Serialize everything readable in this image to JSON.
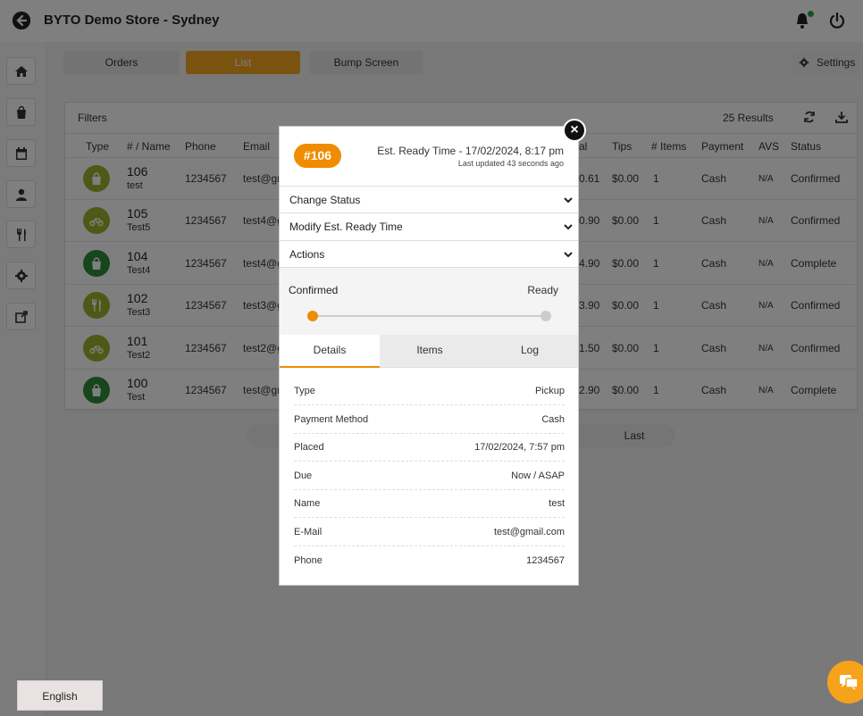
{
  "header": {
    "title": "BYTO Demo Store - Sydney"
  },
  "tabs": {
    "orders": "Orders",
    "list": "List",
    "bump": "Bump Screen",
    "settings": "Settings"
  },
  "panel": {
    "filters": "Filters",
    "results": "25 Results"
  },
  "table": {
    "headers": [
      "Type",
      "# / Name",
      "Phone",
      "Email",
      "al",
      "Tips",
      "# Items",
      "Payment",
      "AVS",
      "Status"
    ],
    "rows": [
      {
        "num": "106",
        "name": "test",
        "phone": "1234567",
        "email": "test@gm",
        "total": "0.61",
        "tips": "$0.00",
        "items": "1",
        "payment": "Cash",
        "avs": "N/A",
        "status": "Confirmed",
        "type_icon": "bag-icon",
        "color": "#a0b12e"
      },
      {
        "num": "105",
        "name": "Test5",
        "phone": "1234567",
        "email": "test4@g",
        "total": "0.90",
        "tips": "$0.00",
        "items": "1",
        "payment": "Cash",
        "avs": "N/A",
        "status": "Confirmed",
        "type_icon": "bike-icon",
        "color": "#a0b12e"
      },
      {
        "num": "104",
        "name": "Test4",
        "phone": "1234567",
        "email": "test4@g",
        "total": "4.90",
        "tips": "$0.00",
        "items": "1",
        "payment": "Cash",
        "avs": "N/A",
        "status": "Complete",
        "type_icon": "bag-icon",
        "color": "#2e8b3a"
      },
      {
        "num": "102",
        "name": "Test3",
        "phone": "1234567",
        "email": "test3@g",
        "total": "3.90",
        "tips": "$0.00",
        "items": "1",
        "payment": "Cash",
        "avs": "N/A",
        "status": "Confirmed",
        "type_icon": "cutlery-icon",
        "color": "#a0b12e"
      },
      {
        "num": "101",
        "name": "Test2",
        "phone": "1234567",
        "email": "test2@g",
        "total": "1.50",
        "tips": "$0.00",
        "items": "1",
        "payment": "Cash",
        "avs": "N/A",
        "status": "Confirmed",
        "type_icon": "bike-icon",
        "color": "#a0b12e"
      },
      {
        "num": "100",
        "name": "Test",
        "phone": "1234567",
        "email": "test@gm",
        "total": "2.90",
        "tips": "$0.00",
        "items": "1",
        "payment": "Cash",
        "avs": "N/A",
        "status": "Complete",
        "type_icon": "bag-icon",
        "color": "#2e8b3a"
      }
    ]
  },
  "pagination": {
    "last": "Last"
  },
  "modal": {
    "order_number": "#106",
    "est_label": "Est. Ready Time - ",
    "est_value": "17/02/2024, 8:17 pm",
    "updated": "Last updated 43 seconds ago",
    "accordions": [
      "Change Status",
      "Modify Est. Ready Time",
      "Actions"
    ],
    "progress": {
      "from": "Confirmed",
      "to": "Ready",
      "value": 0
    },
    "tabs": [
      "Details",
      "Items",
      "Log"
    ],
    "active_tab": "Details",
    "details": [
      {
        "k": "Type",
        "v": "Pickup"
      },
      {
        "k": "Payment Method",
        "v": "Cash"
      },
      {
        "k": "Placed",
        "v": "17/02/2024, 7:57 pm"
      },
      {
        "k": "Due",
        "v": "Now / ASAP"
      },
      {
        "k": "Name",
        "v": "test"
      },
      {
        "k": "E-Mail",
        "v": "test@gmail.com"
      },
      {
        "k": "Phone",
        "v": "1234567"
      }
    ],
    "close": "×"
  },
  "footer": {
    "language": "English"
  },
  "colors": {
    "accent": "#f08c00",
    "tab_active": "#f5a623",
    "olive": "#a0b12e",
    "green": "#2e8b3a",
    "online": "#28a745"
  }
}
